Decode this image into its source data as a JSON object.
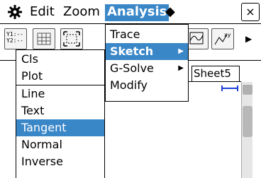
{
  "menubar": {
    "edit": "Edit",
    "zoom": "Zoom",
    "analysis": "Analysis",
    "diamond": "◆",
    "close": "×"
  },
  "toolbar": {
    "tb1_icon": "Y1:—\nY2:—",
    "more": "▶"
  },
  "analysis_menu": {
    "items": [
      {
        "label": "Trace",
        "has_submenu": false
      },
      {
        "label": "Sketch",
        "has_submenu": true,
        "selected": true
      },
      {
        "label": "G-Solve",
        "has_submenu": true
      },
      {
        "label": "Modify",
        "has_submenu": false
      }
    ]
  },
  "sketch_menu": {
    "items": [
      {
        "label": "Cls"
      },
      {
        "label": "Plot"
      },
      {
        "label": "Line"
      },
      {
        "label": "Text"
      },
      {
        "label": "Tangent",
        "selected": true
      },
      {
        "label": "Normal"
      },
      {
        "label": "Inverse"
      }
    ]
  },
  "sheet_tab": "Sheet5",
  "colors": {
    "highlight": "#3a87c8",
    "series": "#1b3fd6"
  }
}
